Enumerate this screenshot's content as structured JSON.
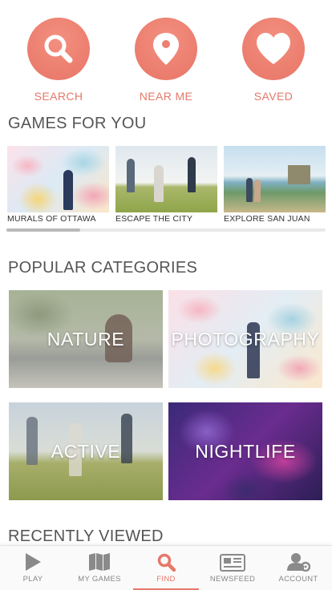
{
  "actions": {
    "search": {
      "label": "SEARCH",
      "icon": "search-icon"
    },
    "near_me": {
      "label": "NEAR ME",
      "icon": "map-pin-icon"
    },
    "saved": {
      "label": "SAVED",
      "icon": "heart-icon"
    }
  },
  "sections": {
    "games_for_you": "GAMES FOR YOU",
    "popular_categories": "POPULAR CATEGORIES",
    "recently_viewed": "RECENTLY VIEWED"
  },
  "games": [
    {
      "title": "MURALS OF OTTAWA"
    },
    {
      "title": "ESCAPE THE CITY"
    },
    {
      "title": "EXPLORE SAN JUAN"
    }
  ],
  "categories": [
    {
      "label": "NATURE"
    },
    {
      "label": "PHOTOGRAPHY"
    },
    {
      "label": "ACTIVE"
    },
    {
      "label": "NIGHTLIFE"
    }
  ],
  "carousel": {
    "scroll_fraction": 0.23
  },
  "nav": {
    "play": "PLAY",
    "my_games": "MY GAMES",
    "find": "FIND",
    "newsfeed": "NEWSFEED",
    "account": "ACCOUNT",
    "active": "find"
  },
  "colors": {
    "accent": "#e5786a",
    "accent_circle": "#ec7f70",
    "inactive": "#888888"
  }
}
